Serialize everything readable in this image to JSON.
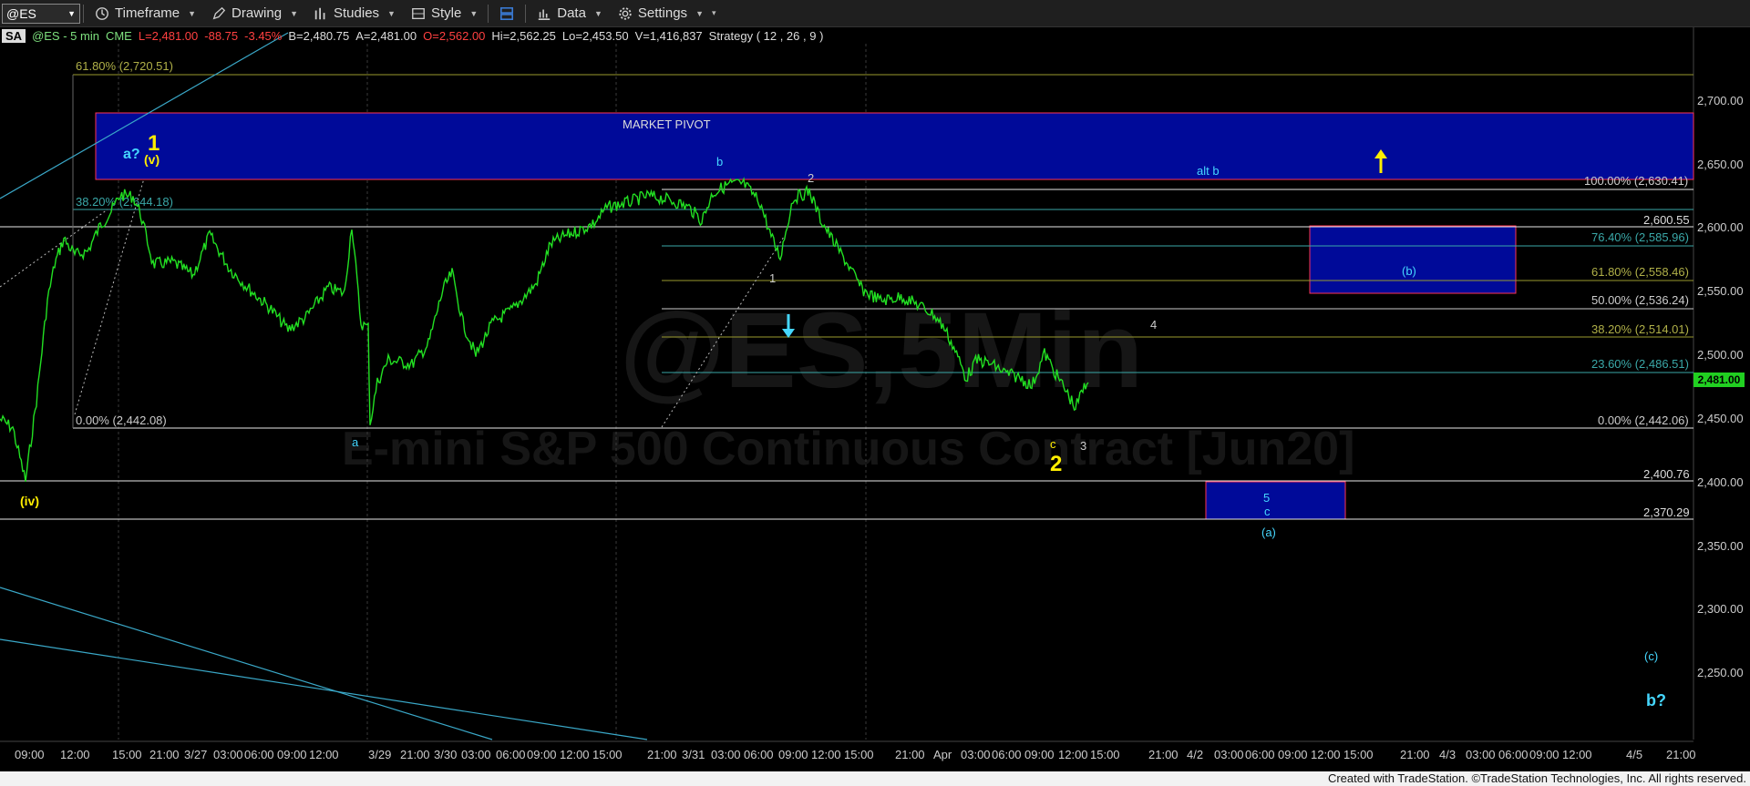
{
  "toolbar": {
    "symbol": "@ES",
    "timeframe": "Timeframe",
    "drawing": "Drawing",
    "studies": "Studies",
    "style": "Style",
    "data": "Data",
    "settings": "Settings"
  },
  "infobar": {
    "badge": "SA",
    "symbol": "@ES - 5 min",
    "exchange": "CME",
    "last": "L=2,481.00",
    "change": "-88.75",
    "change_pct": "-3.45%",
    "bid": "B=2,480.75",
    "ask": "A=2,481.00",
    "open": "O=2,562.00",
    "high": "Hi=2,562.25",
    "low": "Lo=2,453.50",
    "volume": "V=1,416,837",
    "strategy": "Strategy  ( 12 , 26 , 9 )"
  },
  "watermark": {
    "symbol": "@ES,5Min",
    "description": "E-mini S&P 500 Continuous Contract [Jun20]"
  },
  "colors": {
    "price": "#22e022",
    "background": "#000000",
    "zone_fill": "#000a99",
    "zone_border": "#ff3355",
    "fib_white": "#ffffff",
    "fib_teal": "#3aa8a8",
    "fib_olive": "#9a9a2e",
    "wave_yellow": "#ffee00",
    "wave_cyan": "#45d7ff"
  },
  "price_scale": {
    "ticks": [
      "2,700.00",
      "2,650.00",
      "2,600.00",
      "2,550.00",
      "2,500.00",
      "2,450.00",
      "2,400.00",
      "2,350.00",
      "2,300.00",
      "2,250.00"
    ],
    "current": "2,481.00"
  },
  "time_axis": {
    "labels": [
      "09:00",
      "12:00",
      "15:00",
      "21:00",
      "3/27",
      "03:00",
      "06:00",
      "09:00",
      "12:00",
      "3/29",
      "21:00",
      "3/30",
      "03:00",
      "06:00",
      "09:00",
      "12:00",
      "15:00",
      "21:00",
      "3/31",
      "03:00",
      "06:00",
      "09:00",
      "12:00",
      "15:00",
      "21:00",
      "Apr",
      "03:00",
      "06:00",
      "09:00",
      "12:00",
      "15:00",
      "21:00",
      "4/2",
      "03:00",
      "06:00",
      "09:00",
      "12:00",
      "15:00",
      "21:00",
      "4/3",
      "03:00",
      "06:00",
      "09:00",
      "12:00",
      "4/5",
      "21:00"
    ]
  },
  "fib_right": {
    "f100": "100.00% (2,630.41)",
    "f764": "76.40% (2,585.96)",
    "f618": "61.80% (2,558.46)",
    "f50": "50.00% (2,536.24)",
    "f382": "38.20% (2,514.01)",
    "f236": "23.60% (2,486.51)",
    "f0": "0.00% (2,442.06)"
  },
  "fib_left": {
    "f618": "61.80% (2,720.51)",
    "f382": "38.20% (2,644.18)",
    "f0": "0.00% (2,442.08)"
  },
  "levels": {
    "l1": "2,600.55",
    "l2": "2,400.76",
    "l3": "2,370.29"
  },
  "zones": {
    "pivot": "MARKET PIVOT",
    "b_zone": "(b)",
    "c_zone_5": "5",
    "c_zone_c": "c"
  },
  "waves": {
    "w1": "1",
    "a_q": "a?",
    "v": "(v)",
    "iv": "(iv)",
    "a": "a",
    "b": "b",
    "w2_small": "2",
    "w1_small": "1",
    "c": "c",
    "w2_big": "2",
    "w3": "3",
    "w4": "4",
    "alt_b": "alt b",
    "a_paren": "(a)",
    "c_paren": "(c)",
    "b_q": "b?"
  },
  "footer": "Created with TradeStation. ©TradeStation Technologies, Inc. All rights reserved."
}
